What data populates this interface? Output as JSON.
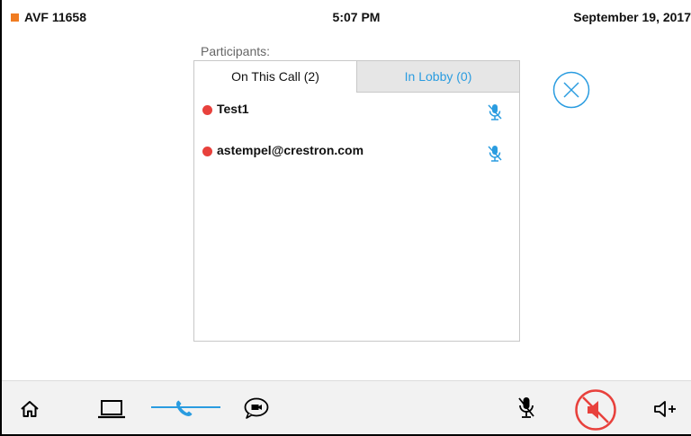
{
  "status": {
    "room_name": "AVF 11658",
    "time": "5:07 PM",
    "date": "September 19, 2017"
  },
  "participants": {
    "title": "Participants:",
    "tabs": [
      {
        "label": "On This Call (2)",
        "active": true
      },
      {
        "label": "In Lobby (0)",
        "active": false
      }
    ],
    "list": [
      {
        "name": "Test1",
        "status_color": "#e8413c",
        "mic_icon": "mic-muted-icon"
      },
      {
        "name": "astempel@crestron.com",
        "status_color": "#e8413c",
        "mic_icon": "mic-muted-icon"
      }
    ]
  },
  "nav": {
    "items": [
      "home-icon",
      "laptop-icon",
      "phone-icon",
      "video-chat-icon"
    ],
    "active": "phone-icon",
    "right_controls": [
      "mic-muted-icon",
      "speaker-muted-icon",
      "volume-up-icon"
    ]
  },
  "colors": {
    "accent": "#2a9ce0",
    "room_indicator": "#f07c22",
    "muted_red": "#e8413c"
  }
}
